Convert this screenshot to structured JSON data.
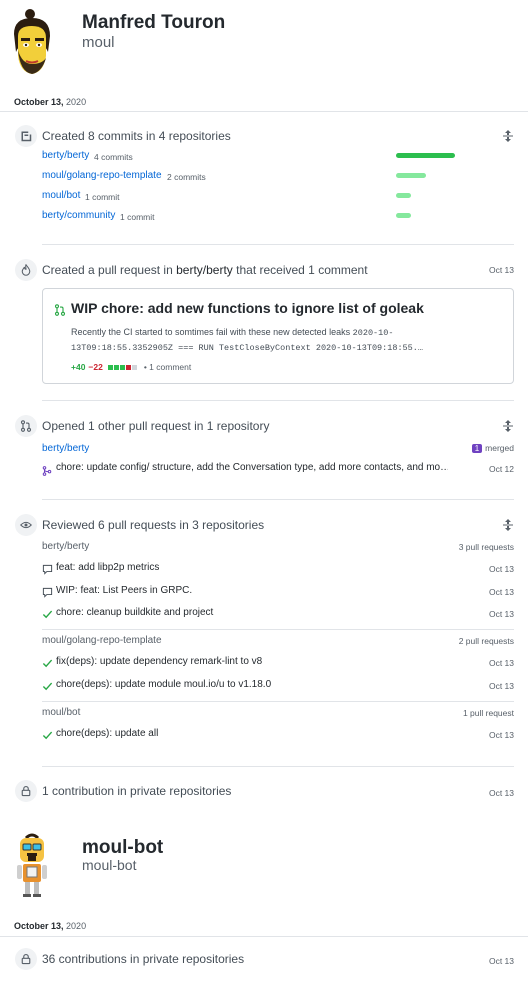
{
  "user1": {
    "name": "Manfred Touron",
    "login": "moul",
    "date": "October 13,",
    "year": "2020"
  },
  "commits": {
    "title": "Created 8 commits in 4 repositories",
    "repos": [
      {
        "name": "berty/berty",
        "count": "4 commits",
        "share": 1.0
      },
      {
        "name": "moul/golang-repo-template",
        "count": "2 commits",
        "share": 0.5
      },
      {
        "name": "moul/bot",
        "count": "1 commit",
        "share": 0.25
      },
      {
        "name": "berty/community",
        "count": "1 commit",
        "share": 0.25
      }
    ]
  },
  "created_pr": {
    "title_prefix": "Created a pull request in",
    "repo": "berty/berty",
    "title_suffix": "that received 1 comment",
    "date": "Oct 13",
    "card": {
      "title": "WIP chore: add new functions to ignore list of goleak",
      "body_text": "Recently the CI started to somtimes fail with these new detected leaks",
      "code_line1": "2020-10-",
      "code_line2": "13T09:18:55.3352905Z === RUN TestCloseByContext 2020-10-13T09:18:55.…",
      "additions": "+40",
      "deletions": "−22",
      "comments": "• 1 comment"
    }
  },
  "opened_pr": {
    "title": "Opened 1 other pull request in 1 repository",
    "repo": "berty/berty",
    "badge_count": "1",
    "badge_label": "merged",
    "item_text": "chore: update config/ structure, add the Conversation type, add more contacts, and mo…",
    "item_date": "Oct 12"
  },
  "reviewed": {
    "title": "Reviewed 6 pull requests in 3 repositories",
    "groups": [
      {
        "repo": "berty/berty",
        "count": "3 pull requests",
        "items": [
          {
            "text": "feat: add libp2p metrics",
            "date": "Oct 13",
            "icon": "comment"
          },
          {
            "text": "WIP: feat: List Peers in GRPC.",
            "date": "Oct 13",
            "icon": "comment"
          },
          {
            "text": "chore: cleanup buildkite and project",
            "date": "Oct 13",
            "icon": "check"
          }
        ]
      },
      {
        "repo": "moul/golang-repo-template",
        "count": "2 pull requests",
        "items": [
          {
            "text": "fix(deps): update dependency remark-lint to v8",
            "date": "Oct 13",
            "icon": "check"
          },
          {
            "text": "chore(deps): update module moul.io/u to v1.18.0",
            "date": "Oct 13",
            "icon": "check"
          }
        ]
      },
      {
        "repo": "moul/bot",
        "count": "1 pull request",
        "items": [
          {
            "text": "chore(deps): update all",
            "date": "Oct 13",
            "icon": "check"
          }
        ]
      }
    ]
  },
  "private1": {
    "title": "1 contribution in private repositories",
    "date": "Oct 13"
  },
  "user2": {
    "name": "moul-bot",
    "login": "moul-bot",
    "date": "October 13,",
    "year": "2020"
  },
  "private2": {
    "title": "36 contributions in private repositories",
    "date": "Oct 13"
  },
  "colors": {
    "bar_dark": "#2cbe4e",
    "bar_light": "#85e89d",
    "link": "#0366d6",
    "merged": "#6f42c1"
  }
}
